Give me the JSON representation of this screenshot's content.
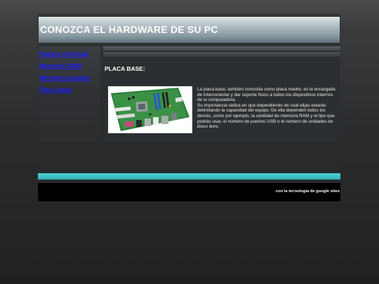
{
  "header": {
    "site_title": "CONOZCA EL HARDWARE DE SU PC"
  },
  "sidebar": {
    "items": [
      {
        "label": "Pagina principal"
      },
      {
        "label": "Memoria RAM"
      },
      {
        "label": "Microprocesador"
      },
      {
        "label": "Placa base"
      }
    ]
  },
  "main": {
    "title": "PLACA BASE:",
    "paragraphs": [
      "La placa base, también conocida como placa madre, es la encargada de interconectar y dar soporte físico a todos los dispositivos internos de tu computadora.",
      "Su importancia radica en que dependiendo de cual elijas estarás delimitando la capacidad del equipo. De ella dependen todos los demás, como por ejemplo, la cantidad de memoria RAM y el tipo que podrás usar, el número de puertos USB o el número de unidades de disco duro."
    ]
  },
  "footer": {
    "text": "con la tecnología de google sites"
  },
  "colors": {
    "link": "#1a1aff",
    "accent": "#3cc3c8",
    "footer_bg": "#000000"
  }
}
